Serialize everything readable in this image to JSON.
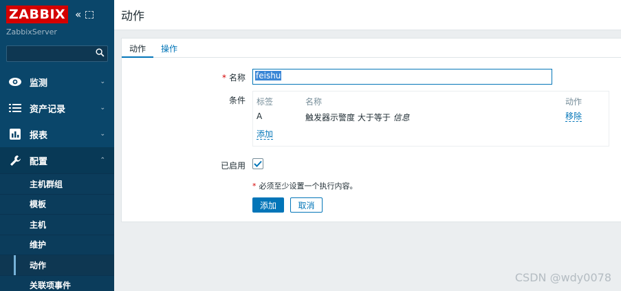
{
  "sidebar": {
    "logo": "ZABBIX",
    "server_name": "ZabbixServer",
    "search_value": "",
    "menu": [
      {
        "label": "监测",
        "icon": "eye-icon"
      },
      {
        "label": "资产记录",
        "icon": "list-icon"
      },
      {
        "label": "报表",
        "icon": "bar-chart-icon"
      },
      {
        "label": "配置",
        "icon": "wrench-icon"
      }
    ],
    "submenu": [
      "主机群组",
      "模板",
      "主机",
      "维护",
      "动作",
      "关联项事件"
    ]
  },
  "page": {
    "title": "动作"
  },
  "tabs": [
    "动作",
    "操作"
  ],
  "form": {
    "name_label": "名称",
    "name_value": "feishu",
    "conditions_label": "条件",
    "conditions": {
      "headers": {
        "tag": "标签",
        "name": "名称",
        "action": "动作"
      },
      "rows": [
        {
          "tag": "A",
          "name_prefix": "触发器示警度 大于等于 ",
          "name_value": "信息",
          "action": "移除"
        }
      ],
      "add_link": "添加"
    },
    "enabled_label": "已启用",
    "enabled": true,
    "note": "必须至少设置一个执行内容。",
    "add_button": "添加",
    "cancel_button": "取消"
  },
  "watermark": "CSDN @wdy0078",
  "colors": {
    "sidebar_bg": "#0a466a",
    "logo_bg": "#d40000",
    "accent": "#0275b8"
  }
}
